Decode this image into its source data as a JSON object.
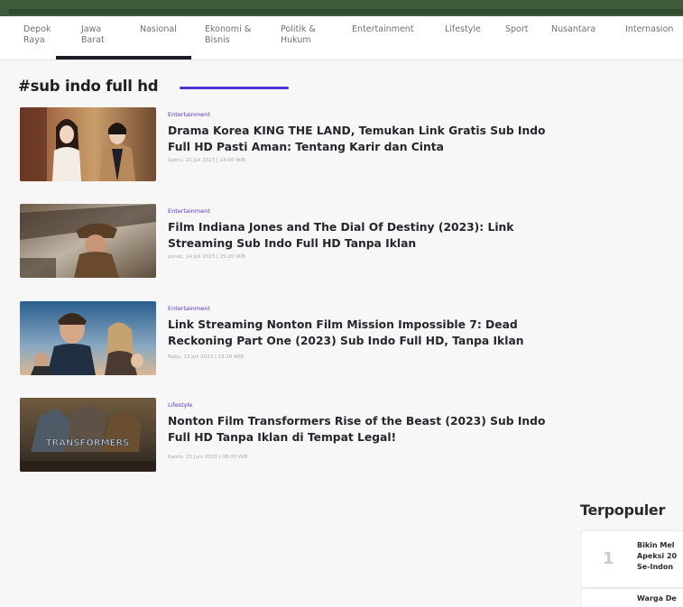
{
  "nav": {
    "items": [
      {
        "label": "Depok\nRaya"
      },
      {
        "label": "Jawa\nBarat"
      },
      {
        "label": "Nasional"
      },
      {
        "label": "Ekonomi &\nBisnis"
      },
      {
        "label": "Politik &\nHukum"
      },
      {
        "label": "Entertainment"
      },
      {
        "label": "Lifestyle"
      },
      {
        "label": "Sport"
      },
      {
        "label": "Nusantara"
      },
      {
        "label": "Internasion"
      }
    ]
  },
  "tag": {
    "title": "#sub indo full hd"
  },
  "articles": [
    {
      "category": "Entertainment",
      "title": "Drama Korea KING THE LAND, Temukan Link Gratis Sub Indo Full HD Pasti Aman: Tentang Karir dan Cinta",
      "date": "Sabtu, 15 Juli 2023 | 14:00 WIB"
    },
    {
      "category": "Entertainment",
      "title": "Film Indiana Jones and The Dial Of Destiny (2023): Link Streaming Sub Indo Full HD Tanpa Iklan",
      "date": "Jumat, 14 Juli 2023 | 15:20 WIB"
    },
    {
      "category": "Entertainment",
      "title": "Link Streaming Nonton Film Mission Impossible 7: Dead Reckoning Part One (2023) Sub Indo Full HD, Tanpa Iklan",
      "date": "Rabu, 12 Juli 2023 | 13:20 WIB"
    },
    {
      "category": "Lifestyle",
      "title": "Nonton Film Transformers Rise of the Beast (2023) Sub Indo Full HD Tanpa Iklan di Tempat Legal!",
      "date": "Kamis, 15 Juni 2023 | 08:00 WIB",
      "thumb_text": "TRANSFORMERS"
    }
  ],
  "popular": {
    "title": "Terpopuler",
    "items": [
      {
        "rank": "1",
        "text": "Bikin Mel\nApeksi 20\nSe-Indon"
      },
      {
        "text": "Warga De"
      }
    ]
  },
  "colors": {
    "accent": "#4f35d9",
    "category": "#5a34d6",
    "topbar": "#3e5a3a"
  }
}
